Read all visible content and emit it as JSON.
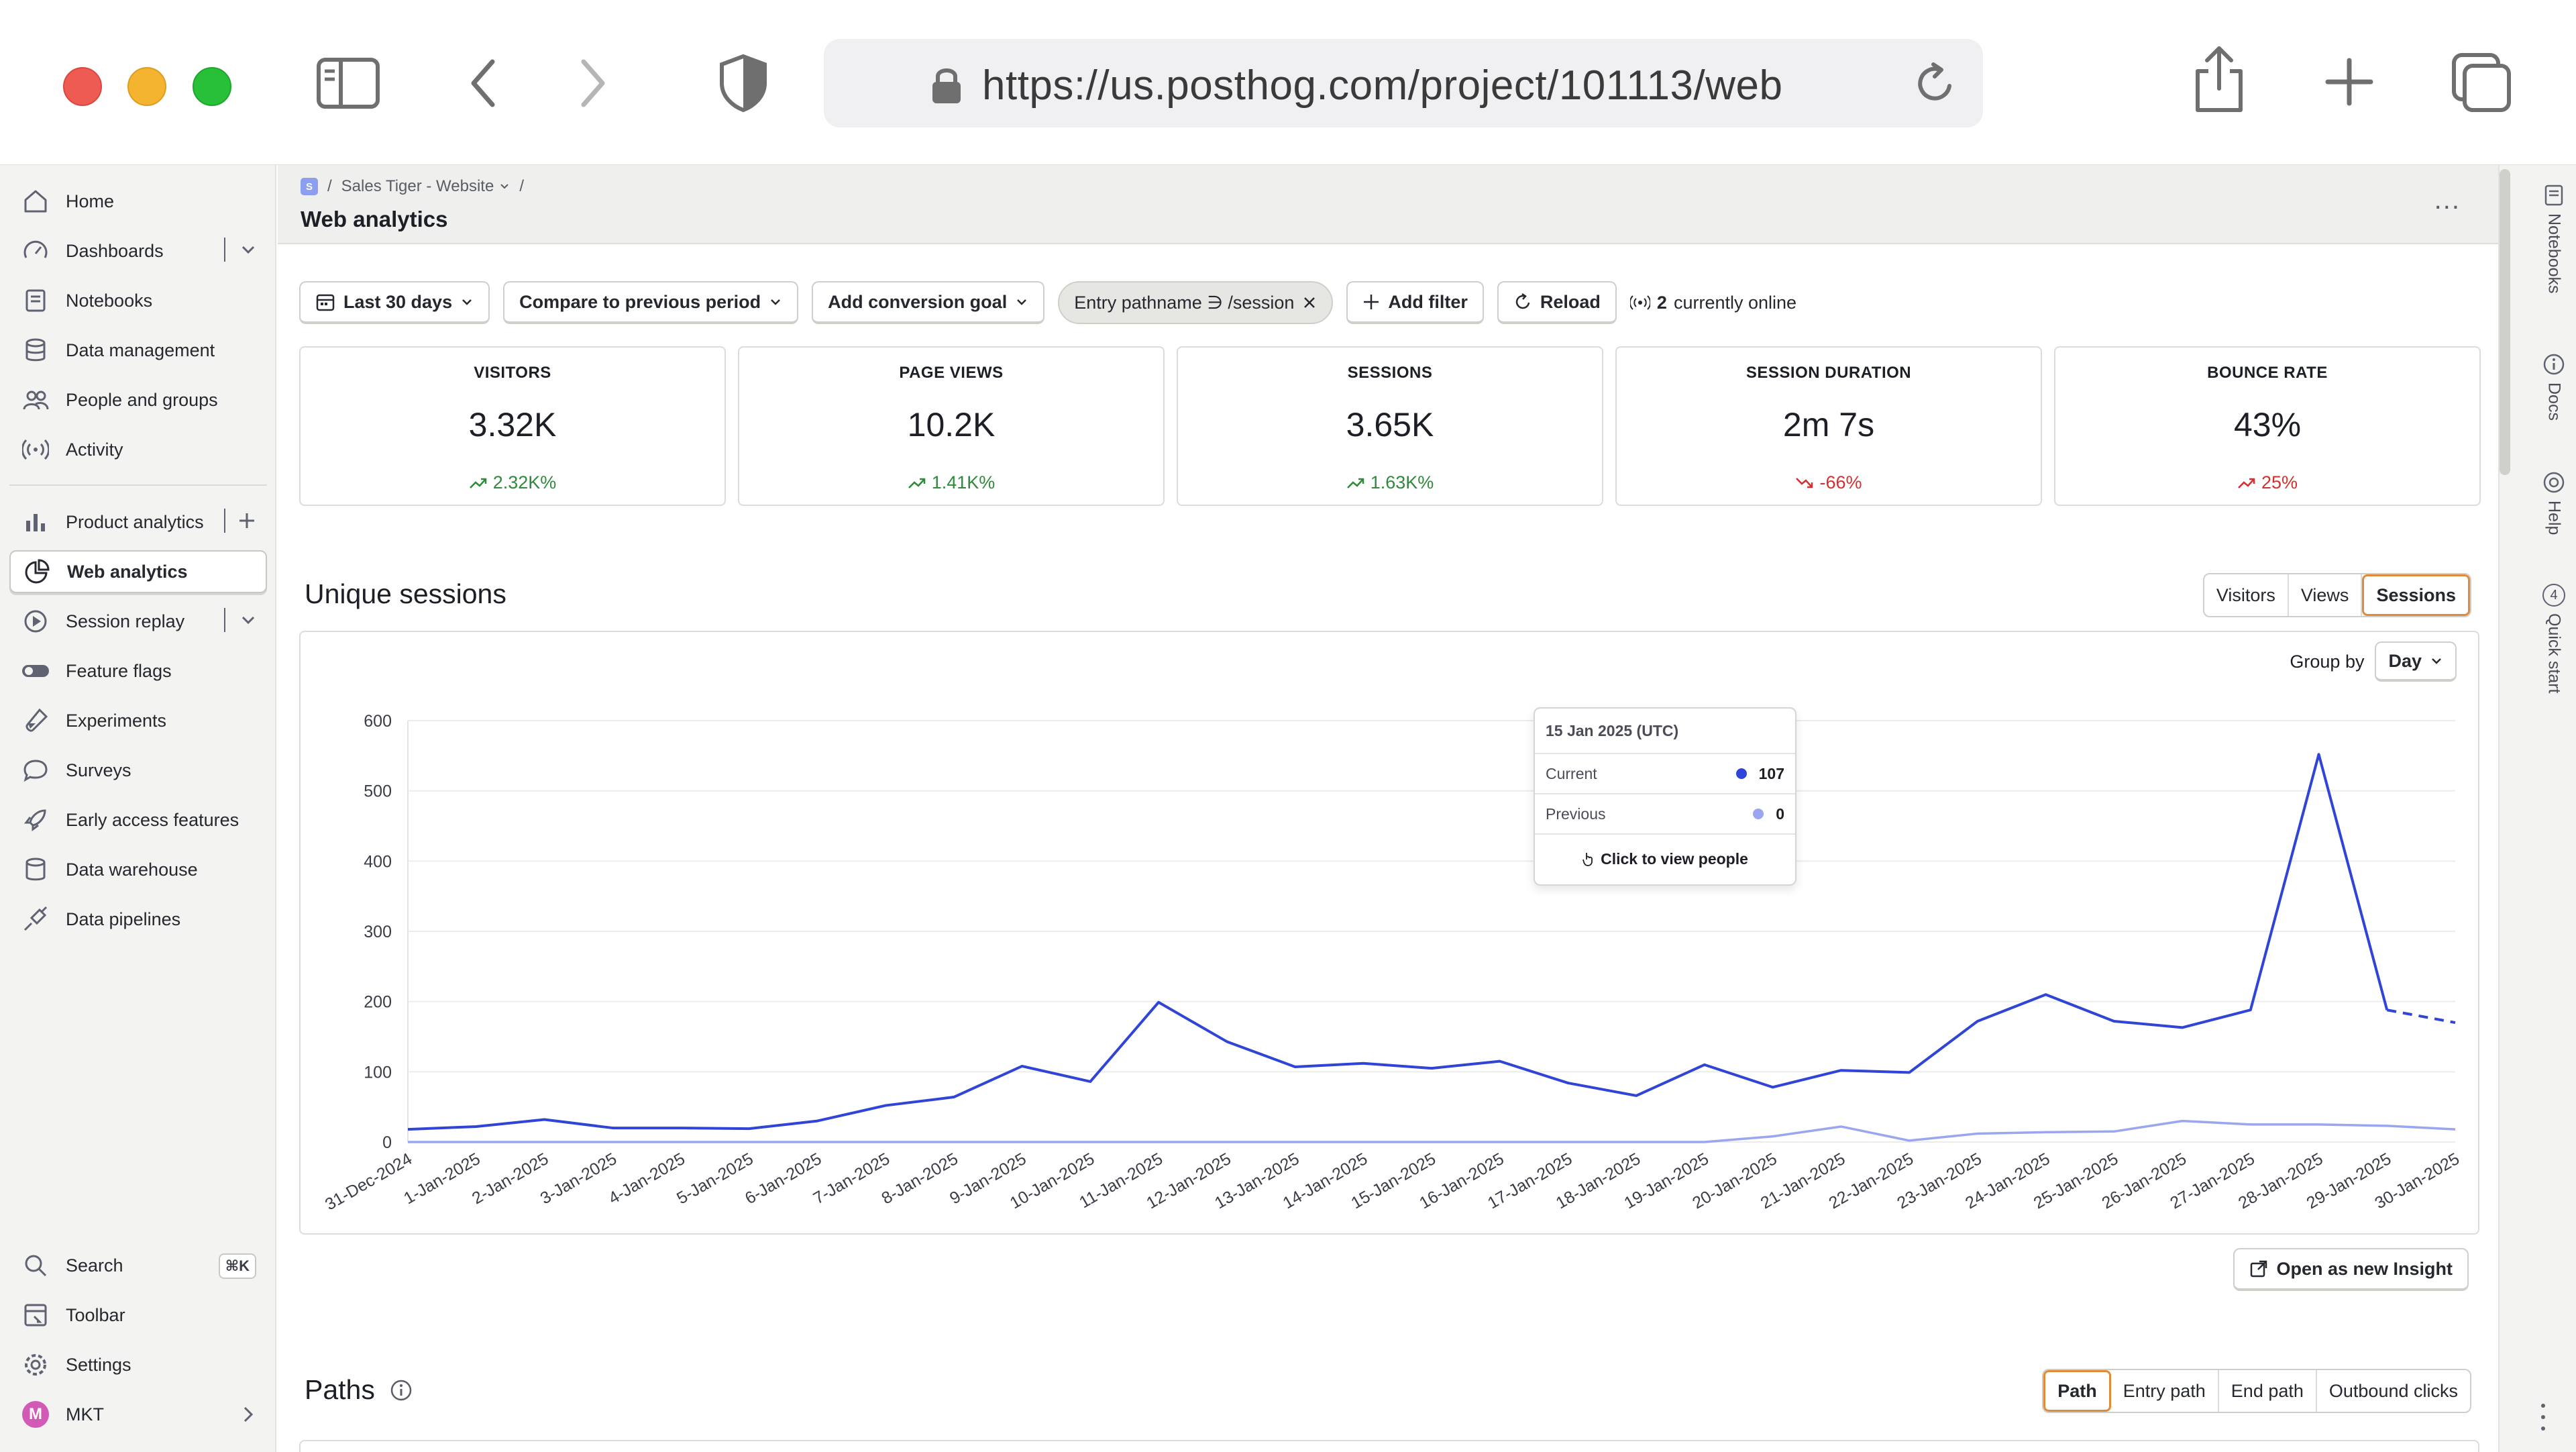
{
  "browser": {
    "url": "https://us.posthog.com/project/101113/web"
  },
  "sidebar": {
    "items": [
      {
        "label": "Home",
        "icon": "home-icon"
      },
      {
        "label": "Dashboards",
        "icon": "dashboard-icon"
      },
      {
        "label": "Notebooks",
        "icon": "notebook-icon"
      },
      {
        "label": "Data management",
        "icon": "database-icon"
      },
      {
        "label": "People and groups",
        "icon": "people-icon"
      },
      {
        "label": "Activity",
        "icon": "activity-icon"
      },
      {
        "label": "Product analytics",
        "icon": "bar-chart-icon"
      },
      {
        "label": "Web analytics",
        "icon": "pie-chart-icon"
      },
      {
        "label": "Session replay",
        "icon": "play-icon"
      },
      {
        "label": "Feature flags",
        "icon": "toggle-icon"
      },
      {
        "label": "Experiments",
        "icon": "flask-icon"
      },
      {
        "label": "Surveys",
        "icon": "chat-icon"
      },
      {
        "label": "Early access features",
        "icon": "rocket-icon"
      },
      {
        "label": "Data warehouse",
        "icon": "warehouse-icon"
      },
      {
        "label": "Data pipelines",
        "icon": "pipeline-icon"
      }
    ],
    "bottom": {
      "search_label": "Search",
      "search_shortcut": "⌘K",
      "toolbar_label": "Toolbar",
      "settings_label": "Settings",
      "user_initial": "M",
      "user_label": "MKT"
    }
  },
  "header": {
    "project_badge": "S",
    "breadcrumb_project": "Sales Tiger - Website",
    "separator": "/",
    "title": "Web analytics",
    "more": "..."
  },
  "filters": {
    "date_range": "Last 30 days",
    "compare": "Compare to previous period",
    "conversion": "Add conversion goal",
    "entry_filter": "Entry pathname ∋ /session",
    "add_filter": "Add filter",
    "reload": "Reload",
    "online_count": "2",
    "online_text": "currently online"
  },
  "metrics": [
    {
      "label": "VISITORS",
      "value": "3.32K",
      "change": "2.32K%",
      "trend": "up"
    },
    {
      "label": "PAGE VIEWS",
      "value": "10.2K",
      "change": "1.41K%",
      "trend": "up"
    },
    {
      "label": "SESSIONS",
      "value": "3.65K",
      "change": "1.63K%",
      "trend": "up"
    },
    {
      "label": "SESSION DURATION",
      "value": "2m 7s",
      "change": "-66%",
      "trend": "down"
    },
    {
      "label": "BOUNCE RATE",
      "value": "43%",
      "change": "25%",
      "trend": "down"
    }
  ],
  "sessions_section": {
    "title": "Unique sessions",
    "toggle": [
      "Visitors",
      "Views",
      "Sessions"
    ],
    "active_toggle": "Sessions",
    "group_by_label": "Group by",
    "group_by_value": "Day",
    "open_insight": "Open as new Insight"
  },
  "tooltip": {
    "date": "15 Jan 2025 (UTC)",
    "current_label": "Current",
    "current_value": "107",
    "previous_label": "Previous",
    "previous_value": "0",
    "action": "Click to view people"
  },
  "paths_section": {
    "title": "Paths",
    "tabs": [
      "Path",
      "Entry path",
      "End path",
      "Outbound clicks"
    ],
    "active_tab": "Path"
  },
  "right_rail": {
    "items": [
      "Notebooks",
      "Docs",
      "Help",
      "Quick start"
    ],
    "quick_start_badge": "4"
  },
  "colors": {
    "current": "#3045d8",
    "previous": "#9aa6ef",
    "accent": "#e08a3c",
    "positive": "#2f8a3b",
    "negative": "#d52f2f"
  },
  "chart_data": {
    "type": "line",
    "categories": [
      "31-Dec-2024",
      "1-Jan-2025",
      "2-Jan-2025",
      "3-Jan-2025",
      "4-Jan-2025",
      "5-Jan-2025",
      "6-Jan-2025",
      "7-Jan-2025",
      "8-Jan-2025",
      "9-Jan-2025",
      "10-Jan-2025",
      "11-Jan-2025",
      "12-Jan-2025",
      "13-Jan-2025",
      "14-Jan-2025",
      "15-Jan-2025",
      "16-Jan-2025",
      "17-Jan-2025",
      "18-Jan-2025",
      "19-Jan-2025",
      "20-Jan-2025",
      "21-Jan-2025",
      "22-Jan-2025",
      "23-Jan-2025",
      "24-Jan-2025",
      "25-Jan-2025",
      "26-Jan-2025",
      "27-Jan-2025",
      "28-Jan-2025",
      "29-Jan-2025",
      "30-Jan-2025"
    ],
    "series": [
      {
        "name": "Current",
        "values": [
          18,
          22,
          32,
          20,
          20,
          19,
          30,
          52,
          64,
          108,
          86,
          199,
          143,
          107,
          112,
          105,
          115,
          84,
          66,
          110,
          78,
          102,
          99,
          172,
          210,
          172,
          163,
          188,
          552,
          188,
          170
        ],
        "dashed_last": true
      },
      {
        "name": "Previous",
        "values": [
          0,
          0,
          0,
          0,
          0,
          0,
          0,
          0,
          0,
          0,
          0,
          0,
          0,
          0,
          0,
          0,
          0,
          0,
          0,
          0,
          8,
          22,
          2,
          12,
          14,
          15,
          30,
          25,
          25,
          23,
          18
        ]
      }
    ],
    "ylim": [
      0,
      600
    ],
    "yticks": [
      0,
      100,
      200,
      300,
      400,
      500,
      600
    ],
    "xlabel": "",
    "ylabel": "",
    "grid": true
  }
}
